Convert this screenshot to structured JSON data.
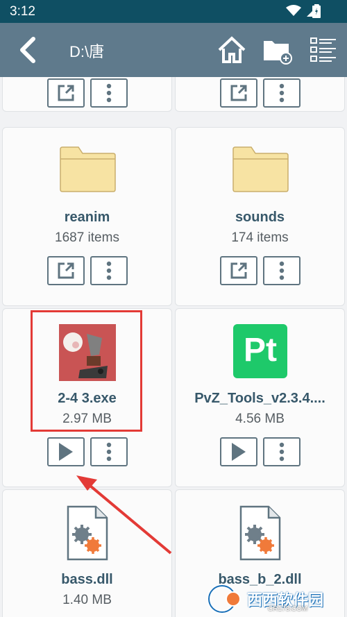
{
  "status": {
    "time": "3:12"
  },
  "header": {
    "path": "D:\\唐"
  },
  "files": [
    {
      "name": "reanim",
      "meta": "1687 items",
      "type": "folder"
    },
    {
      "name": "sounds",
      "meta": "174 items",
      "type": "folder"
    },
    {
      "name": "2-4 3.exe",
      "meta": "2.97 MB",
      "type": "exe"
    },
    {
      "name": "PvZ_Tools_v2.3.4....",
      "meta": "4.56 MB",
      "type": "app",
      "icon_text": "Pt"
    },
    {
      "name": "bass.dll",
      "meta": "1.40 MB",
      "type": "dll"
    },
    {
      "name": "bass_b_2.dll",
      "meta": "",
      "type": "dll"
    }
  ],
  "watermark": {
    "text": "西西软件园",
    "sub": "CR173.COM"
  },
  "colors": {
    "status_bar": "#0f4f63",
    "app_bar": "#5f7a8c",
    "folder": "#f7e3a3",
    "title": "#37586a",
    "highlight": "#e33a36",
    "pt_green": "#1ec96a"
  }
}
